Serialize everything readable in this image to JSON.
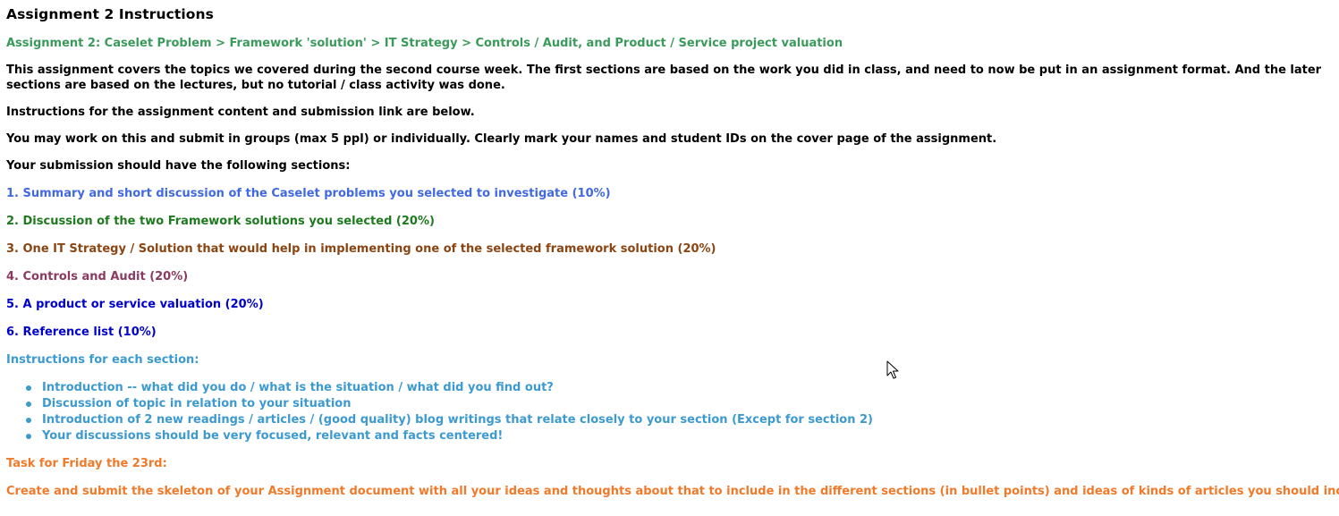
{
  "page": {
    "title": "Assignment 2 Instructions",
    "breadcrumb": "Assignment 2: Caselet Problem > Framework 'solution' > IT Strategy > Controls / Audit, and Product / Service project valuation",
    "intro": "This assignment covers the topics we covered during the second course week. The first sections are based on the work you did in class, and need to now be put in an assignment format. And the later sections are based on the lectures, but no tutorial / class activity was done.",
    "instructions_line": "Instructions for the assignment content and submission link are below.",
    "groups_line": "You may work on this and submit in groups (max 5 ppl) or individually. Clearly mark your names and student IDs on the cover page of the assignment.",
    "sections_intro": "Your submission should have the following sections:",
    "sections": [
      {
        "label": "1. Summary and short discussion of the Caselet problems you selected to investigate (10%)",
        "color": "#4169e1"
      },
      {
        "label": "2. Discussion of the two Framework solutions you selected (20%)",
        "color": "#1e7a1e"
      },
      {
        "label": "3. One IT Strategy / Solution that would help in implementing one of the selected framework solution (20%)",
        "color": "#8b4513"
      },
      {
        "label": "4. Controls  and Audit (20%)",
        "color": "#8b3a62"
      },
      {
        "label": "5. A product or service valuation  (20%)",
        "color": "#0000cd"
      },
      {
        "label": "6. Reference list (10%)",
        "color": "#0000cd"
      }
    ],
    "each_section_heading": "Instructions for each section:",
    "bullets": [
      "Introduction -- what did you do / what is the situation / what did you find out?",
      "Discussion of topic in relation to your situation",
      "Introduction of 2 new readings / articles / (good quality) blog writings that relate closely to your section (Except for section 2)",
      "Your discussions should be very focused, relevant and facts centered!"
    ],
    "task_heading": "Task for Friday the 23rd:",
    "task_text": "Create and submit the skeleton of your Assignment document with all your ideas and thoughts about that to include in the different sections (in bullet points) and ideas of kinds of articles you should include!"
  },
  "colors": {
    "breadcrumb": "#3a9a5b",
    "each_section": "#3c9ad0",
    "task": "#f07a2a"
  },
  "icons": {
    "cursor": "mouse-pointer-icon"
  }
}
